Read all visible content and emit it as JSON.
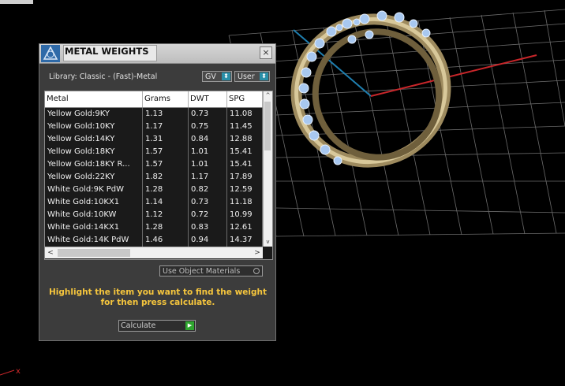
{
  "panel": {
    "title": "METAL WEIGHTS",
    "close": "×",
    "library": "Library: Classic - (Fast)-Metal",
    "dropdowns": [
      {
        "label": "GV",
        "arrow": "⬍"
      },
      {
        "label": "User",
        "arrow": "⬍"
      }
    ]
  },
  "table": {
    "headers": [
      "Metal",
      "Grams",
      "DWT",
      "SPG"
    ],
    "rows": [
      [
        "Yellow Gold:9KY",
        "1.13",
        "0.73",
        "11.08"
      ],
      [
        "Yellow Gold:10KY",
        "1.17",
        "0.75",
        "11.45"
      ],
      [
        "Yellow Gold:14KY",
        "1.31",
        "0.84",
        "12.88"
      ],
      [
        "Yellow Gold:18KY",
        "1.57",
        "1.01",
        "15.41"
      ],
      [
        "Yellow Gold:18KY R...",
        "1.57",
        "1.01",
        "15.41"
      ],
      [
        "Yellow Gold:22KY",
        "1.82",
        "1.17",
        "17.89"
      ],
      [
        "White Gold:9K PdW",
        "1.28",
        "0.82",
        "12.59"
      ],
      [
        "White Gold:10KX1",
        "1.14",
        "0.73",
        "11.18"
      ],
      [
        "White Gold:10KW",
        "1.12",
        "0.72",
        "10.99"
      ],
      [
        "White Gold:14KX1",
        "1.28",
        "0.83",
        "12.61"
      ],
      [
        "White Gold:14K PdW",
        "1.46",
        "0.94",
        "14.37"
      ]
    ],
    "scroll_up": "^",
    "scroll_down": "v",
    "scroll_left": "<",
    "scroll_right": ">"
  },
  "use_object_materials": "Use Object Materials",
  "hint": "Highlight the item you want to find the weight for then press calculate.",
  "calculate": {
    "label": "Calculate",
    "go": "▶"
  },
  "viewport": {
    "axis_label": "x"
  },
  "colors": {
    "accent": "#f6c63d",
    "axis_red": "#c8262a",
    "axis_blue": "#1f7fb0",
    "go_green": "#2fa62f"
  }
}
